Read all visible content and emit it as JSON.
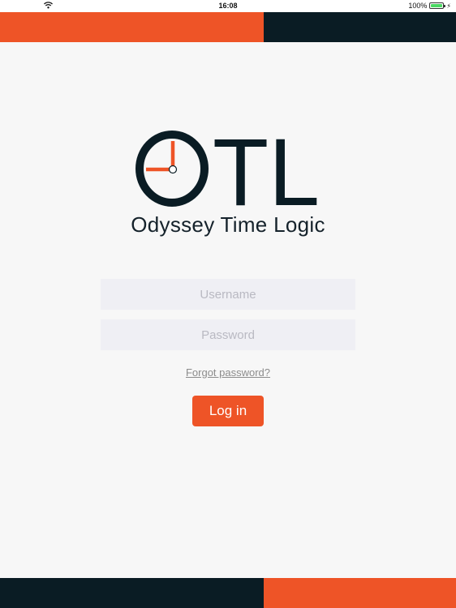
{
  "status_bar": {
    "time": "16:08",
    "battery_text": "100%"
  },
  "colors": {
    "accent": "#ee5427",
    "dark": "#0a1c24",
    "field_bg": "#efeff4",
    "background": "#f7f7f7"
  },
  "logo": {
    "letters": "TL",
    "tagline": "Odyssey Time Logic"
  },
  "form": {
    "username_placeholder": "Username",
    "username_value": "",
    "password_placeholder": "Password",
    "password_value": "",
    "forgot_label": "Forgot password?",
    "login_label": "Log in"
  },
  "icons": [
    "wifi-icon",
    "battery-icon",
    "charging-icon",
    "clock-logo-icon"
  ]
}
